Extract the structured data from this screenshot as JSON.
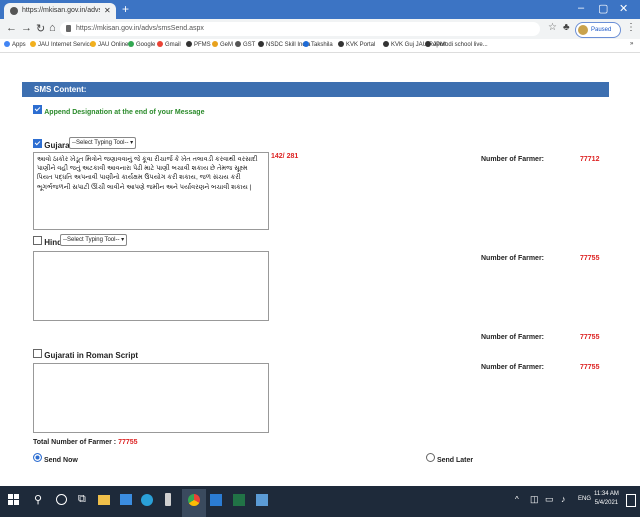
{
  "browser": {
    "tab_title": "https://mkisan.gov.in/advs/smsS",
    "url": "https://mkisan.gov.in/advs/smsSend.aspx",
    "profile_status": "Paused",
    "bookmarks": [
      {
        "label": "Apps",
        "color": "#4285f4"
      },
      {
        "label": "JAU Internet Service",
        "color": "#f2b01e"
      },
      {
        "label": "JAU Online",
        "color": "#f2b01e"
      },
      {
        "label": "Google",
        "color": "#34a853"
      },
      {
        "label": "Gmail",
        "color": "#ea4335"
      },
      {
        "label": "PFMS",
        "color": "#333"
      },
      {
        "label": "GeM",
        "color": "#e8a21e"
      },
      {
        "label": "GST",
        "color": "#555"
      },
      {
        "label": "NSDC Skill India",
        "color": "#333"
      },
      {
        "label": "Takshila",
        "color": "#1e6bd6"
      },
      {
        "label": "KVK Portal",
        "color": "#333"
      },
      {
        "label": "KVK Guj JAU Report",
        "color": "#333"
      },
      {
        "label": "JPModi school live...",
        "color": "#333"
      }
    ]
  },
  "form": {
    "section_title": "SMS Content:",
    "append_designation": "Append Designation at the end of your Message",
    "gujarati": {
      "label": "Gujarati",
      "typing_tool": "--Select Typing Tool--",
      "message": "આવો ઠાકોર ખેડૂત મિત્રોને જણાવવાનું જે કૂવા રીચાર્જ કે ખેત તલાવડી કરવાથી વરસાદી પાણીને વહી જતું અટકાવી  આવનારા પેઢી માટે પાણી બચાવી શકાય છે તેમજ સૂક્ષ્મ પિયત પદ્ધતિ અપનાવી પાણીનો કાર્યક્ષમ ઉપયોગ કરી શકાય, જળ સંચય કરી ભૂગર્ભજળની સપાટી ઊંચી લાવીને  આપણે જમીન અને પર્યાવરણને બચાવી શકાય |",
      "char_count": "142/ 281",
      "farmers_label": "Number of Farmer:",
      "farmers_value": "77712"
    },
    "hindi": {
      "label": "Hindi",
      "typing_tool": "--Select Typing Tool--",
      "farmers_label": "Number of Farmer:",
      "farmers_value": "77755"
    },
    "roman": {
      "label": "Gujarati in Roman Script",
      "farmers_label_1": "Number of Farmer:",
      "farmers_value_1": "77755",
      "farmers_label_2": "Number of Farmer:",
      "farmers_value_2": "77755"
    },
    "total_label": "Total Number of Farmer :",
    "total_value": "77755",
    "send_now": "Send Now",
    "send_later": "Send Later"
  },
  "taskbar": {
    "time": "11:34 AM",
    "date": "5/4/2021",
    "lang": "ENG"
  }
}
